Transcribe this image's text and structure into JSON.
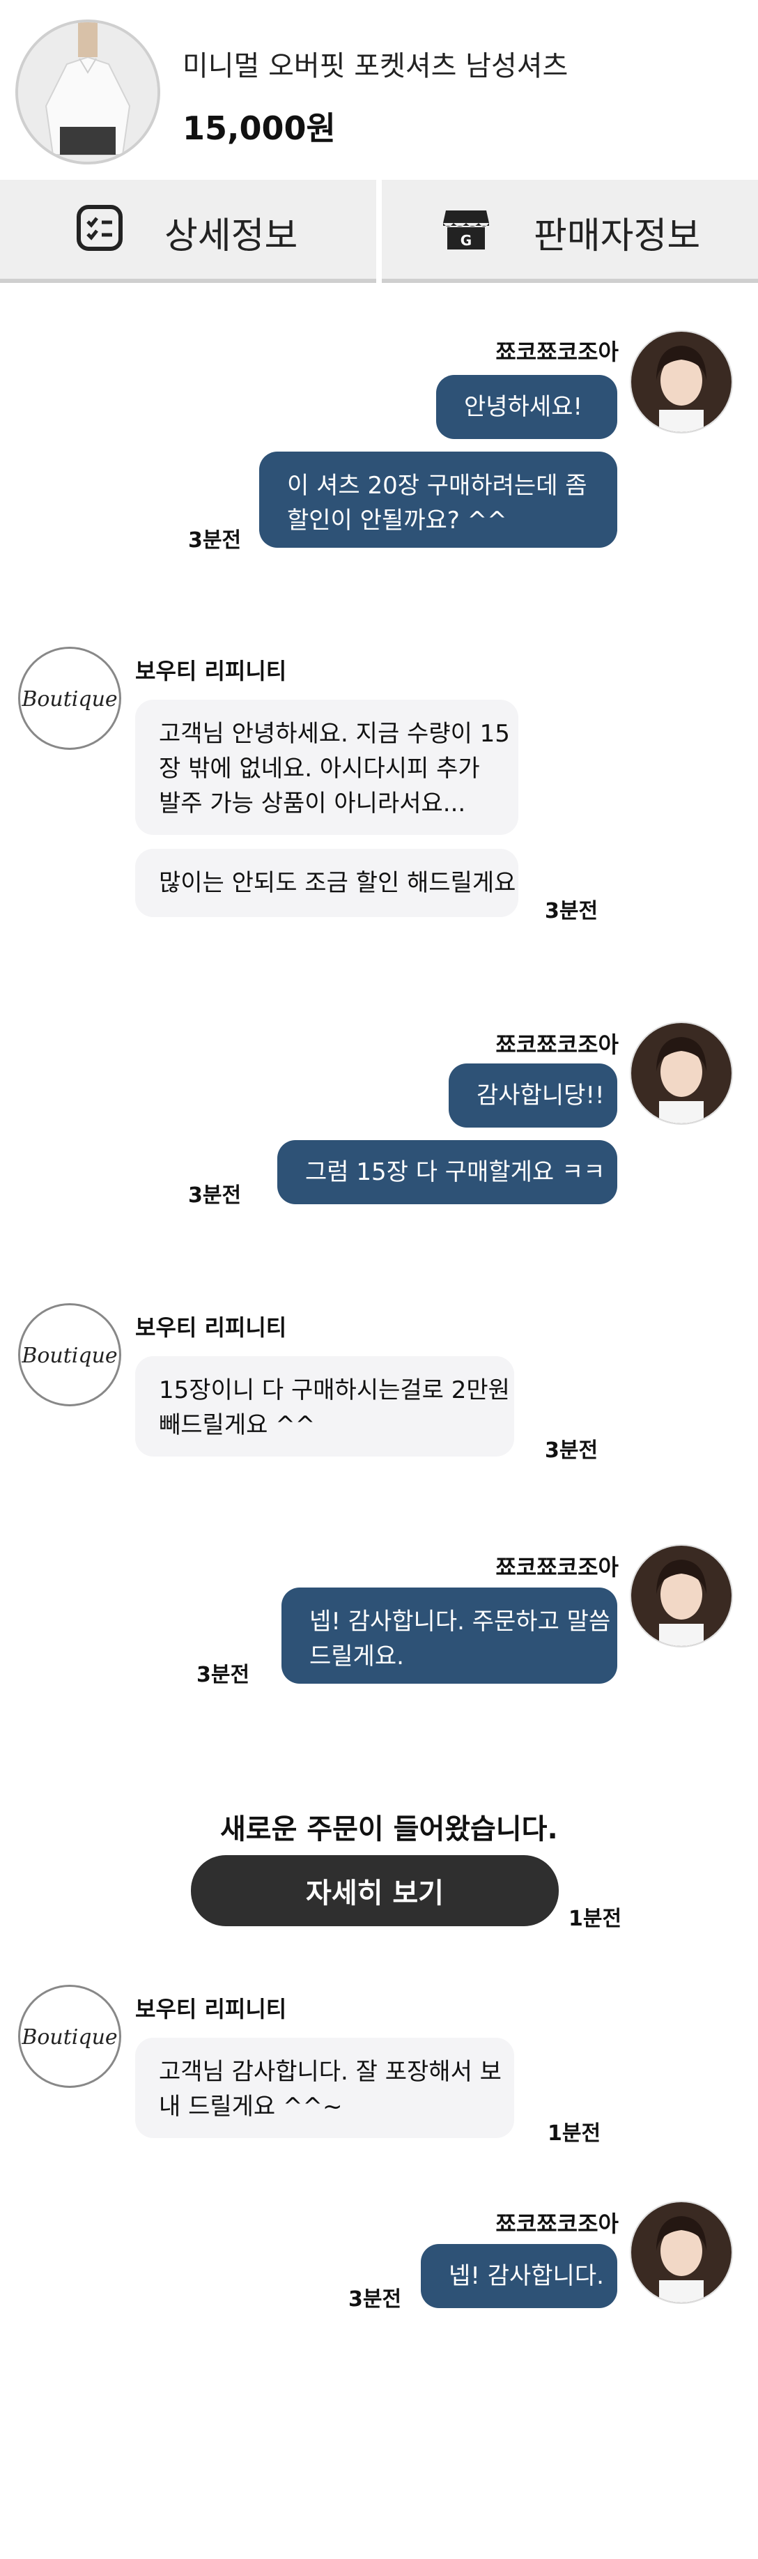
{
  "product": {
    "name": "미니멀 오버핏 포켓셔츠 남성셔츠",
    "price": "15,000원"
  },
  "tabs": [
    {
      "label": "상세정보",
      "icon": "checklist-icon"
    },
    {
      "label": "판매자정보",
      "icon": "store-icon"
    }
  ],
  "buyer": {
    "name": "쬬코쬬코조아"
  },
  "seller": {
    "name": "보우티 리피니티",
    "logo_text": "Boutique"
  },
  "messages": [
    {
      "lines": [
        "안녕하세요!"
      ]
    },
    {
      "lines": [
        "이 셔츠 20장 구매하려는데 좀",
        "할인이 안될까요? ^^"
      ],
      "time": "3분전"
    },
    {
      "lines": [
        "고객님 안녕하세요. 지금 수량이 15",
        "장 밖에 없네요. 아시다시피 추가",
        "발주 가능 상품이 아니라서요..."
      ]
    },
    {
      "lines": [
        "많이는 안되도 조금 할인 해드릴게요"
      ],
      "time": "3분전"
    },
    {
      "lines": [
        "감사합니당!!"
      ]
    },
    {
      "lines": [
        "그럼 15장 다 구매할게요 ㅋㅋ"
      ],
      "time": "3분전"
    },
    {
      "lines": [
        "15장이니 다 구매하시는걸로 2만원",
        "빼드릴게요 ^^"
      ],
      "time": "3분전"
    },
    {
      "lines": [
        "넵! 감사합니다. 주문하고 말씀",
        "드릴게요."
      ],
      "time": "3분전"
    },
    {
      "lines": [
        "고객님 감사합니다. 잘 포장해서 보",
        "내 드릴게요 ^^~"
      ],
      "time": "1분전"
    },
    {
      "lines": [
        "넵! 감사합니다."
      ],
      "time": "3분전"
    }
  ],
  "order_notice": {
    "text": "새로운 주문이 들어왔습니다.",
    "button_label": "자세히 보기",
    "time": "1분전"
  }
}
